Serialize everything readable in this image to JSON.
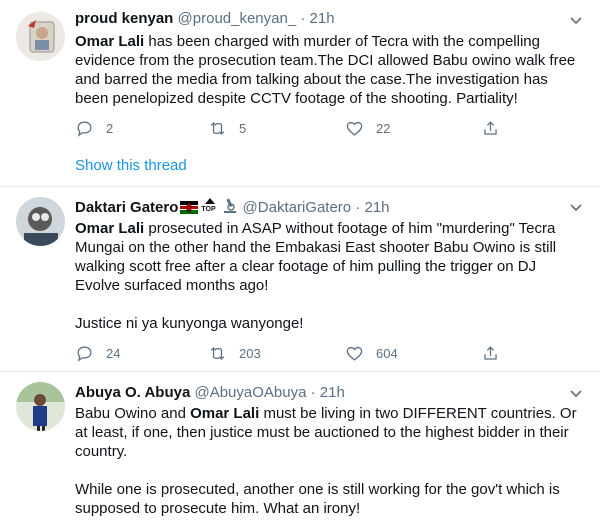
{
  "tweets": [
    {
      "name": "proud kenyan",
      "handle": "@proud_kenyan_",
      "dot": "·",
      "time": "21h",
      "body_parts": [
        {
          "bold": true,
          "text": "Omar Lali"
        },
        {
          "bold": false,
          "text": " has been charged with murder of Tecra with the compelling evidence from the prosecution team.The DCI allowed Babu owino walk free and barred the media from talking about the case.The investigation has been penelopized despite CCTV footage of the shooting. Partiality!"
        }
      ],
      "replies": "2",
      "retweets": "5",
      "likes": "22"
    },
    {
      "name": "Daktari Gatero",
      "handle": "@DaktariGatero",
      "dot": "·",
      "time": "21h",
      "emoji_top_label": "TOP",
      "body_parts": [
        {
          "bold": true,
          "text": "Omar Lali"
        },
        {
          "bold": false,
          "text": " prosecuted in ASAP without footage of him \"murdering\" Tecra Mungai on the other hand the Embakasi East shooter Babu Owino is still walking scott free after a clear footage of him pulling the trigger on DJ Evolve surfaced months ago!"
        }
      ],
      "body_extra": "Justice ni ya kunyonga wanyonge!",
      "replies": "24",
      "retweets": "203",
      "likes": "604"
    },
    {
      "name": "Abuya O. Abuya",
      "handle": "@AbuyaOAbuya",
      "dot": "·",
      "time": "21h",
      "body_parts": [
        {
          "bold": false,
          "text": "Babu Owino and "
        },
        {
          "bold": true,
          "text": "Omar Lali"
        },
        {
          "bold": false,
          "text": " must be living in two DIFFERENT countries. Or at least, if one, then justice must be auctioned to the highest bidder in their country."
        }
      ],
      "body_extra": "While one is prosecuted, another one is still working for the gov't which is supposed to prosecute him. What an irony!"
    }
  ],
  "show_thread_label": "Show this thread",
  "colors": {
    "link": "#1b95e0",
    "muted": "#5b7083",
    "divider": "#e6ecf0",
    "text": "#0f1419"
  },
  "icons": [
    "chevron-down-icon",
    "reply-icon",
    "retweet-icon",
    "like-icon",
    "share-icon",
    "kenya-flag-icon",
    "top-arrow-icon",
    "microscope-icon"
  ]
}
